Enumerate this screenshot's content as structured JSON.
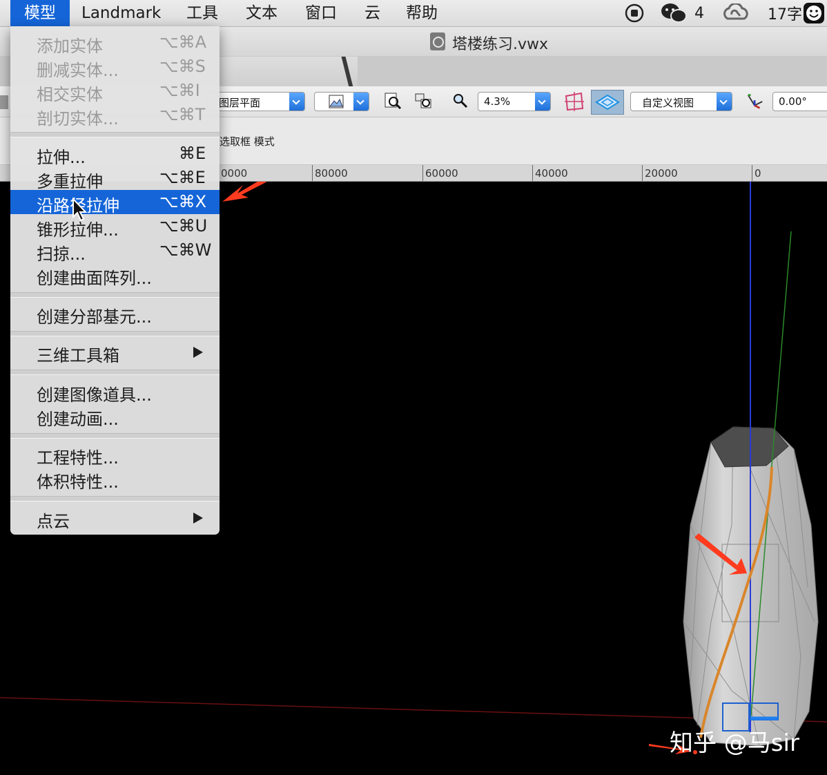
{
  "menubar": {
    "items": [
      "模型",
      "Landmark",
      "工具",
      "文本",
      "窗口",
      "云",
      "帮助"
    ],
    "status": {
      "wechat_count": "4",
      "word_count": "17字"
    }
  },
  "window": {
    "title": "塔楼练习.vwx"
  },
  "viewbar": {
    "layer_plane": "图层平面",
    "zoom": "4.3%",
    "view": "自定义视图",
    "rotation": "0.00°"
  },
  "modebar": {
    "mode_text": "选取框 模式"
  },
  "ruler": {
    "labels": [
      "0000",
      "80000",
      "60000",
      "40000",
      "20000",
      "0"
    ]
  },
  "menu": {
    "items": [
      {
        "label": "添加实体",
        "shortcut": "⌥⌘A",
        "enabled": false
      },
      {
        "label": "删减实体...",
        "shortcut": "⌥⌘S",
        "enabled": false
      },
      {
        "label": "相交实体",
        "shortcut": "⌥⌘I",
        "enabled": false
      },
      {
        "label": "剖切实体...",
        "shortcut": "⌥⌘T",
        "enabled": false
      },
      {
        "label": "拉伸...",
        "shortcut": "⌘E",
        "enabled": true
      },
      {
        "label": "多重拉伸",
        "shortcut": "⌥⌘E",
        "enabled": true
      },
      {
        "label": "沿路径拉伸",
        "shortcut": "⌥⌘X",
        "enabled": true,
        "highlighted": true
      },
      {
        "label": "锥形拉伸...",
        "shortcut": "⌥⌘U",
        "enabled": true
      },
      {
        "label": "扫掠...",
        "shortcut": "⌥⌘W",
        "enabled": true
      },
      {
        "label": "创建曲面阵列...",
        "shortcut": "",
        "enabled": true
      },
      {
        "label": "创建分部基元...",
        "shortcut": "",
        "enabled": true
      },
      {
        "label": "三维工具箱",
        "shortcut": "",
        "enabled": true,
        "submenu": true
      },
      {
        "label": "创建图像道具...",
        "shortcut": "",
        "enabled": true
      },
      {
        "label": "创建动画...",
        "shortcut": "",
        "enabled": true
      },
      {
        "label": "工程特性...",
        "shortcut": "",
        "enabled": true
      },
      {
        "label": "体积特性...",
        "shortcut": "",
        "enabled": true
      },
      {
        "label": "点云",
        "shortcut": "",
        "enabled": true,
        "submenu": true
      }
    ]
  },
  "watermark": "知乎 @马sir",
  "colors": {
    "accent": "#1565d8",
    "annotation_arrow": "#ff3b1f",
    "path_curve": "#d9862b"
  }
}
